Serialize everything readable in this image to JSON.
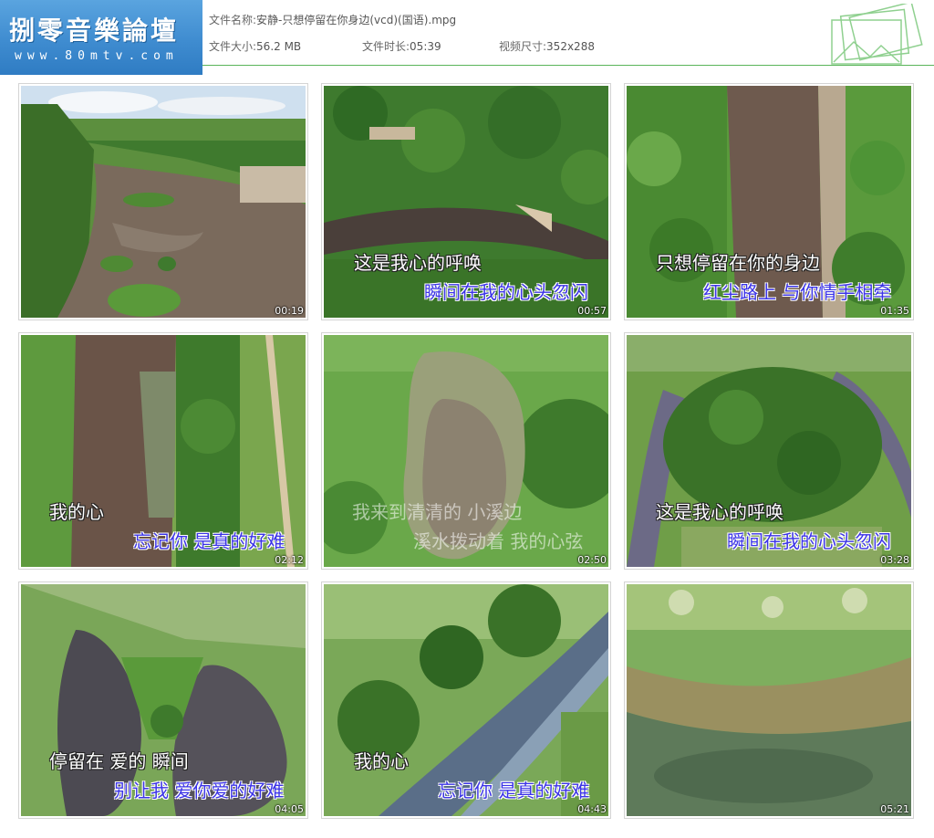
{
  "logo": {
    "title": "捌零音樂論壇",
    "url": "www.80mtv.com"
  },
  "file": {
    "name_label": "文件名称:",
    "name_value": "安静-只想停留在你身边(vcd)(国语).mpg",
    "size_label": "文件大小:",
    "size_value": "56.2 MB",
    "duration_label": "文件时长:",
    "duration_value": "05:39",
    "dims_label": "视频尺寸:",
    "dims_value": "352x288"
  },
  "colors": {
    "accent_line": "#5ab55a",
    "logo_bg": "#3f8cd0",
    "subtitle_blue": "#3b33e6"
  },
  "thumbnails": [
    {
      "time": "00:19",
      "line1": "",
      "line2": "",
      "scene": "river-bank"
    },
    {
      "time": "00:57",
      "line1": "这是我心的呼唤",
      "line2": "瞬间在我的心头忽闪",
      "scene": "forest-river"
    },
    {
      "time": "01:35",
      "line1": "只想停留在你的身边",
      "line2": "红尘路上 与你情手相牵",
      "scene": "river-vertical"
    },
    {
      "time": "02:12",
      "line1": "我的心",
      "line2": "忘记你 是真的好难",
      "scene": "river-road"
    },
    {
      "time": "02:50",
      "line1": "我来到清清的 小溪边",
      "line2": "溪水拨动着 我的心弦",
      "scene": "pond"
    },
    {
      "time": "03:28",
      "line1": "这是我心的呼唤",
      "line2": "瞬间在我的心头忽闪",
      "scene": "oxbow"
    },
    {
      "time": "04:05",
      "line1": "停留在 爱的 瞬间",
      "line2": "别让我 爱你爱的好难",
      "scene": "lakes"
    },
    {
      "time": "04:43",
      "line1": "我的心",
      "line2": "忘记你 是真的好难",
      "scene": "river-diagonal"
    },
    {
      "time": "05:21",
      "line1": "",
      "line2": "",
      "scene": "marsh"
    }
  ]
}
